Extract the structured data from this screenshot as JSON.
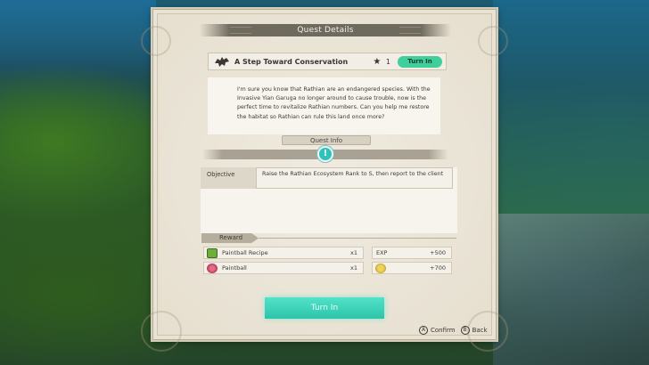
{
  "dialog": {
    "title": "Quest Details"
  },
  "quest": {
    "name": "A Step Toward Conservation",
    "icon": "monster-silhouette-icon",
    "star_count": "1",
    "status_badge": "Turn In",
    "description": "I'm sure you know that Rathian are an endangered species. With the Invasive Yian Garuga no longer around to cause trouble, now is the perfect time to revitalize Rathian numbers. Can you help me restore the habitat so Rathian can rule this land once more?"
  },
  "quest_info": {
    "label": "Quest Info",
    "objective_label": "Objective",
    "objective_value": "Raise the Rathian Ecosystem Rank to S, then report to the client"
  },
  "reward": {
    "label": "Reward",
    "items": [
      {
        "name": "Paintball Recipe",
        "qty": "x1",
        "icon": "recipe-icon"
      },
      {
        "name": "Paintball",
        "qty": "x1",
        "icon": "paintball-icon"
      }
    ],
    "exp": {
      "label": "EXP",
      "value": "+500"
    },
    "money": {
      "value": "+700",
      "icon": "coin-icon"
    }
  },
  "action_button": "Turn In",
  "hints": {
    "confirm_key": "A",
    "confirm_label": "Confirm",
    "back_key": "B",
    "back_label": "Back"
  },
  "colors": {
    "accent": "#3fcf9a",
    "panel": "#e9e3d6",
    "title_bar": "#6f6a5e"
  }
}
